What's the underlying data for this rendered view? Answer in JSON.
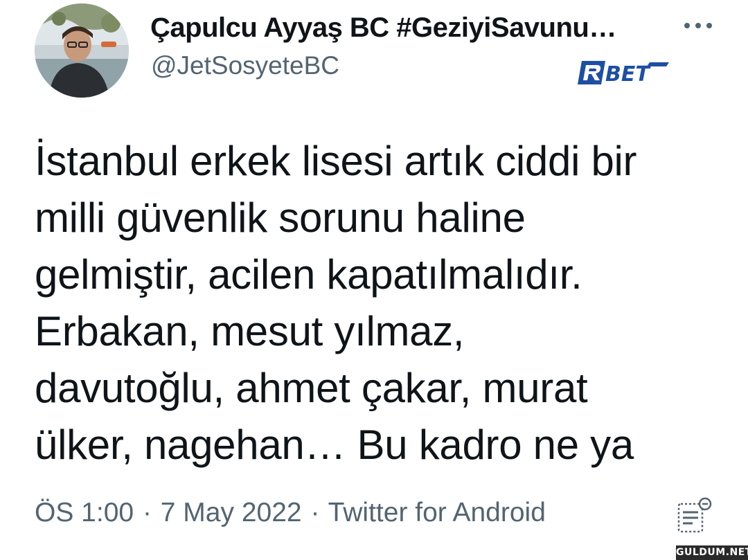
{
  "author": {
    "display_name": "Çapulcu Ayyaş BC #GeziyiSavunu…",
    "handle": "@JetSosyeteBC"
  },
  "logo_text": "RBET",
  "tweet": {
    "lines": [
      "İstanbul erkek lisesi artık ciddi bir",
      "milli güvenlik sorunu haline",
      "gelmiştir, acilen kapatılmalıdır.",
      "Erbakan, mesut yılmaz,",
      "davutoğlu, ahmet çakar, murat",
      "ülker, nagehan… Bu kadro ne ya"
    ]
  },
  "meta": {
    "time": "ÖS 1:00",
    "separator": "·",
    "date": "7 May 2022",
    "source": "Twitter for Android"
  },
  "watermark": "GULDUM.NET",
  "icons": {
    "more": "more-horizontal-icon",
    "analytics": "analytics-icon"
  },
  "colors": {
    "text": "#0f1419",
    "secondary": "#536471",
    "logo_blue": "#1d4fa3"
  }
}
